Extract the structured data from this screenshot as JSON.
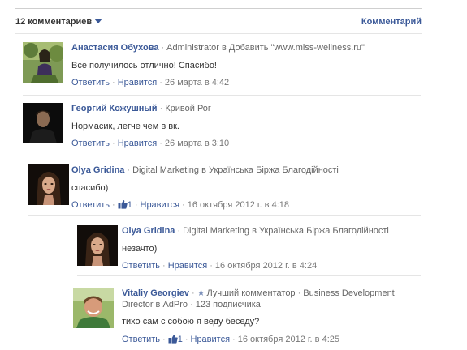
{
  "header": {
    "count_label": "12 комментариев",
    "sort_label": "Комментарий"
  },
  "comments": [
    {
      "author": "Анастасия Обухова",
      "meta": "Administrator в Добавить \"www.miss-wellness.ru\"",
      "text": "Все получилось отлично! Спасибо!",
      "reply": "Ответить",
      "like": "Нравится",
      "time": "26 марта в 4:42"
    },
    {
      "author": "Георгий Кожушный",
      "meta": "Кривой Рог",
      "text": "Нормасик, легче чем в вк.",
      "reply": "Ответить",
      "like": "Нравится",
      "time": "26 марта в 3:10"
    },
    {
      "author": "Olya Gridina",
      "meta": "Digital Marketing в Українська Біржа Благодійності",
      "text": "спасибо)",
      "reply": "Ответить",
      "likes_count": "1",
      "like": "Нравится",
      "time": "16 октября 2012 г. в 4:18"
    },
    {
      "author": "Olya Gridina",
      "meta": "Digital Marketing в Українська Біржа Благодійності",
      "text": "незачто)",
      "reply": "Ответить",
      "like": "Нравится",
      "time": "16 октября 2012 г. в 4:24"
    },
    {
      "author": "Vitaliy Georgiev",
      "badge": "Лучший комментатор",
      "meta": "Business Development",
      "meta2": "Director в AdPro",
      "subscribers": "123 подписчика",
      "text": "тихо сам с собою я веду беседу?",
      "reply": "Ответить",
      "likes_count": "1",
      "like": "Нравится",
      "time": "16 октября 2012 г. в 4:25"
    }
  ],
  "colors": {
    "link": "#3b5998",
    "text": "#333333",
    "meta": "#666666",
    "separator": "#e5e5e5"
  }
}
